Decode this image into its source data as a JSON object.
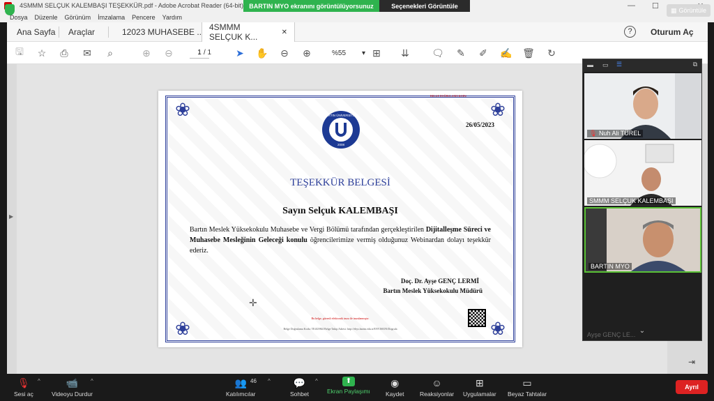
{
  "titlebar": {
    "title": "4SMMM SELÇUK KALEMBAŞI TEŞEKKÜR.pdf - Adobe Acrobat Reader (64-bit)",
    "menu": [
      "Dosya",
      "Düzenle",
      "Görünüm",
      "İmzalama",
      "Pencere",
      "Yardım"
    ]
  },
  "share_banner": {
    "message": "BARTIN MYO ekranını görüntülüyorsunuz",
    "options": "Seçenekleri Görüntüle",
    "view_label": "Görüntüle"
  },
  "tabs": {
    "home": "Ana Sayfa",
    "tools": "Araçlar",
    "doc1": "12023 MUHASEBE ...",
    "doc2": "4SMMM SELÇUK K...",
    "help": "?",
    "signin": "Oturum Aç"
  },
  "toolbar": {
    "page_current": "1",
    "page_total": "/ 1",
    "zoom": "%55"
  },
  "certificate": {
    "date": "26/05/2023",
    "logo_text": "BARTIN ÜNİVERSİTESİ",
    "logo_year": "2008",
    "heading": "TEŞEKKÜR BELGESİ",
    "recipient": "Sayın Selçuk KALEMBAŞI",
    "body_1": "Bartın Meslek Yüksekokulu Muhasebe ve Vergi Bölümü tarafından gerçekleştirilen ",
    "body_bold": "Dijitalleşme Süreci ve Muhasebe Mesleğinin Geleceği konulu",
    "body_2": " öğrencilerimize vermiş olduğunuz Webinardan dolayı teşekkür ederiz.",
    "sign_name": "Doç. Dr. Ayşe GENÇ LERMİ",
    "sign_title": "Bartın Meslek Yüksekokulu Müdürü",
    "red_note": "Bu belge, güvenli elektronik imza ile imzalanmıştır.",
    "footer": "Belge Doğrulama Kodu: TE4G9M4 Belge Takip Adresi: http://ebys.bartin.edu.tr/ENVISION/Dogrula",
    "top_red": "BELGE DOĞRULAMA KODU"
  },
  "video_panel": {
    "participants": [
      {
        "name": "Nuh Ali TÜREL",
        "muted": true
      },
      {
        "name": "SMMM SELÇUK KALEMBAŞI",
        "muted": false
      },
      {
        "name": "BARTIN MYO",
        "muted": false
      }
    ],
    "more_arrow": "⌄",
    "dim_name": "Ayşe GENÇ LE..."
  },
  "zoom_bar": {
    "mute": "Sesi aç",
    "video": "Videoyu Durdur",
    "participants": "Katılımcılar",
    "participant_count": "46",
    "chat": "Sohbet",
    "share": "Ekran Paylaşımı",
    "record": "Kaydet",
    "reactions": "Reaksiyonlar",
    "apps": "Uygulamalar",
    "whiteboards": "Beyaz Tahtalar",
    "leave": "Ayrıl"
  },
  "colors": {
    "share_green": "#2fb34e",
    "cert_blue": "#2d3f9a",
    "leave_red": "#dd2222"
  }
}
